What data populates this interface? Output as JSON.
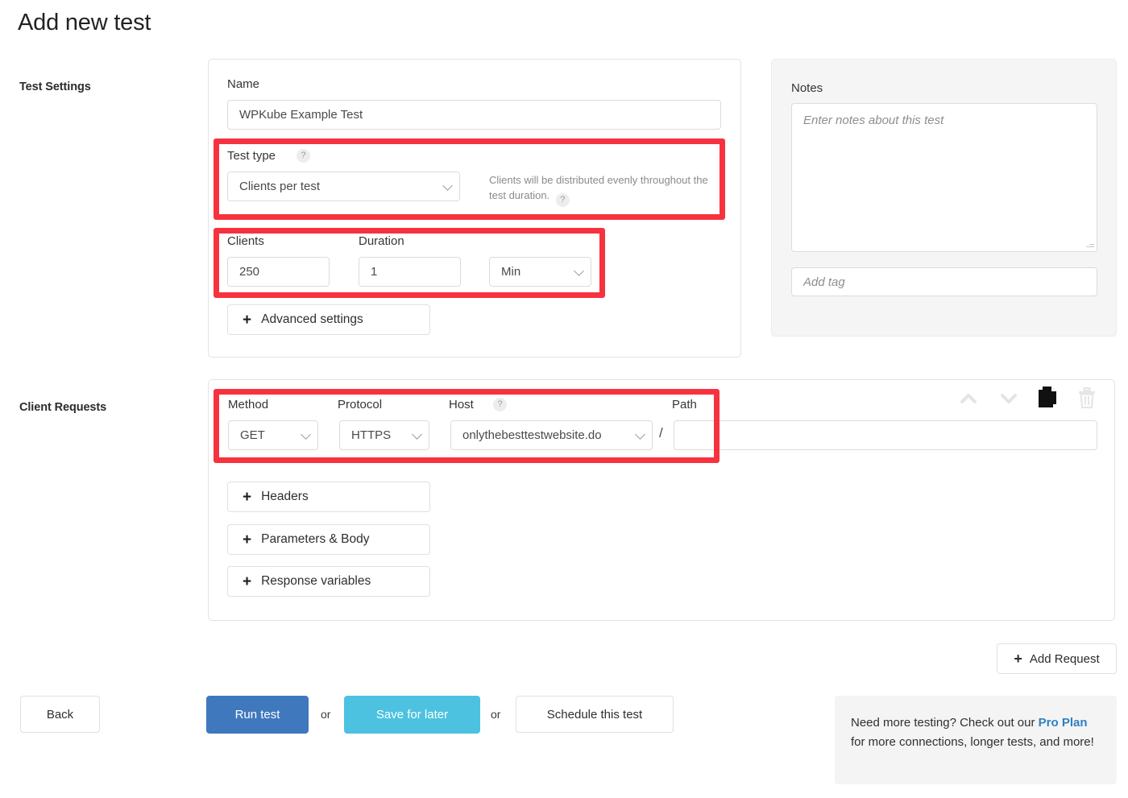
{
  "page": {
    "title": "Add new test"
  },
  "sections": {
    "test_settings_label": "Test Settings",
    "client_requests_label": "Client Requests"
  },
  "test_settings": {
    "name_label": "Name",
    "name_value": "WPKube Example Test",
    "test_type_label": "Test type",
    "test_type_help": "?",
    "test_type_value": "Clients per test",
    "test_type_hint": "Clients will be distributed evenly throughout the test duration.",
    "test_type_hint_help": "?",
    "clients_label": "Clients",
    "clients_value": "250",
    "duration_label": "Duration",
    "duration_value": "1",
    "duration_unit": "Min",
    "advanced_settings_label": "Advanced settings",
    "plus_glyph": "+"
  },
  "notes": {
    "label": "Notes",
    "textarea_placeholder": "Enter notes about this test",
    "textarea_value": "",
    "tag_placeholder": "Add tag",
    "tag_value": ""
  },
  "client_request": {
    "method_label": "Method",
    "method_value": "GET",
    "protocol_label": "Protocol",
    "protocol_value": "HTTPS",
    "host_label": "Host",
    "host_help": "?",
    "host_value": "onlythebesttestwebsite.do",
    "path_label": "Path",
    "path_value": "",
    "path_separator": "/",
    "icons": {
      "move_up": "chevron-up-icon",
      "move_down": "chevron-down-icon",
      "duplicate": "copy-icon",
      "delete": "trash-icon"
    },
    "headers_label": "Headers",
    "parameters_body_label": "Parameters & Body",
    "response_variables_label": "Response variables",
    "plus_glyph": "+"
  },
  "actions": {
    "add_request_label": "Add Request",
    "add_request_plus": "+",
    "back_label": "Back",
    "run_test_label": "Run test",
    "or_1": "or",
    "save_for_later_label": "Save for later",
    "or_2": "or",
    "schedule_label": "Schedule this test"
  },
  "promo": {
    "line_lead": "Need more testing? Check out our",
    "link_text": "Pro Plan",
    "line_tail": "for more connections, longer tests, and more!"
  },
  "colors": {
    "highlight": "#f7323f",
    "run_test_bg": "#3f78bd",
    "save_bg": "#4cc2e0",
    "link": "#2f7fc1"
  }
}
